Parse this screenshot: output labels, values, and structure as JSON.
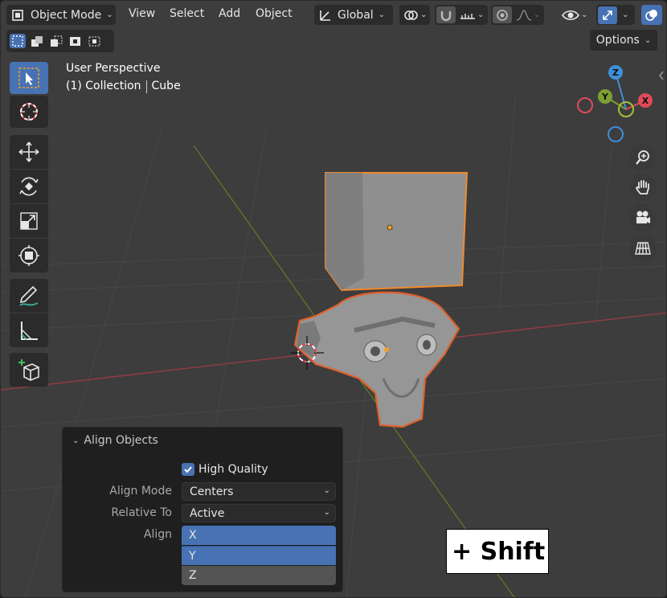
{
  "header": {
    "mode": "Object Mode",
    "menus": [
      "View",
      "Select",
      "Add",
      "Object"
    ],
    "orientation": "Global",
    "options": "Options"
  },
  "viewport_info": {
    "view_name": "User Perspective",
    "collection": "(1) Collection",
    "active_object": "Cube"
  },
  "gizmo": {
    "axes": [
      "Z",
      "Y",
      "X"
    ]
  },
  "align_panel": {
    "title": "Align Objects",
    "high_quality_label": "High Quality",
    "high_quality_checked": true,
    "align_mode_label": "Align Mode",
    "align_mode_value": "Centers",
    "relative_to_label": "Relative To",
    "relative_to_value": "Active",
    "align_label": "Align",
    "axes": [
      {
        "label": "X",
        "enabled": true
      },
      {
        "label": "Y",
        "enabled": true
      },
      {
        "label": "Z",
        "enabled": false
      }
    ]
  },
  "key_hint": "+ Shift",
  "colors": {
    "accent": "#4772b3",
    "selection_outline": "#f08a2c",
    "axis_x": "#e04a5a",
    "axis_y": "#7da033",
    "axis_z": "#3e8fd8"
  }
}
